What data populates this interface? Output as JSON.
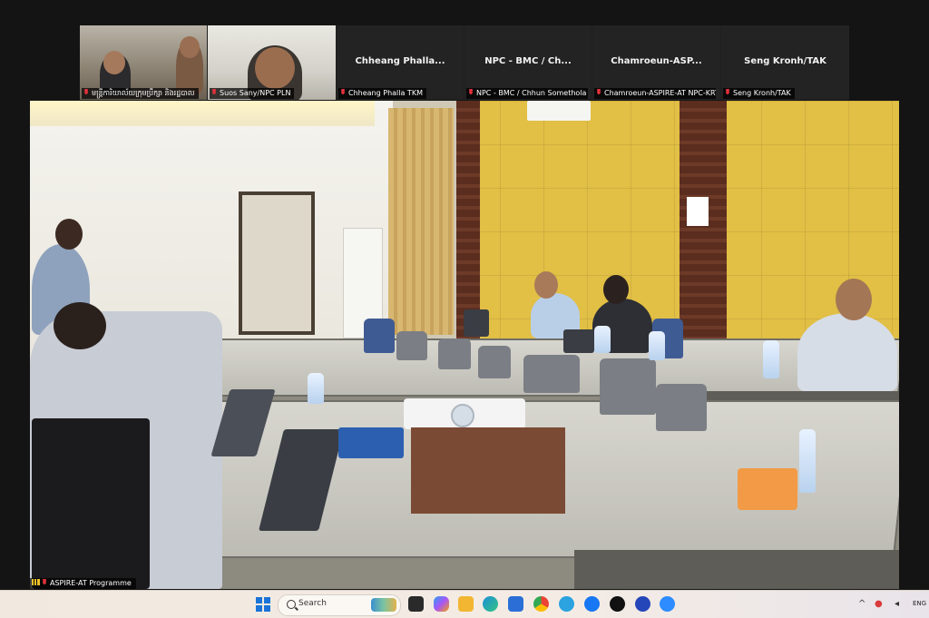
{
  "gallery": {
    "tiles": [
      {
        "name_label": "មន្ត្រីការិយាល័យក្រុមប្រឹក្សា និងរដ្ឋបាល",
        "has_video": true
      },
      {
        "name_label": "Suos Sany/NPC PLN",
        "has_video": true
      },
      {
        "display_name": "Chheang  Phalla...",
        "name_label": "Chheang Phalla TKM",
        "has_video": false
      },
      {
        "display_name": "NPC - BMC /   Ch...",
        "name_label": "NPC - BMC /  Chhun Somethola",
        "has_video": false
      },
      {
        "display_name": "Chamroeun-ASP...",
        "name_label": "Chamroeun-ASPIRE-AT NPC-KRT",
        "has_video": false
      },
      {
        "display_name": "Seng Kronh/TAK",
        "name_label": "Seng Kronh/TAK",
        "has_video": false
      }
    ]
  },
  "main_video": {
    "name_label": "ASPIRE-AT Programme"
  },
  "taskbar": {
    "search_placeholder": "Search",
    "language": "ENG",
    "pinned_icons": [
      "windows-start-icon",
      "search-icon",
      "task-view-icon",
      "copilot-icon",
      "file-explorer-icon",
      "edge-icon",
      "store-icon",
      "chrome-icon",
      "telegram-icon",
      "facebook-icon",
      "tiktok-icon",
      "app-icon",
      "zoom-icon"
    ],
    "tray_icons": [
      "chevron-up-icon",
      "network-icon",
      "volume-icon"
    ]
  },
  "colors": {
    "mic_muted": "#e0313a",
    "zoom_blue": "#2d8cff",
    "wall_yellow": "#e2bf45"
  }
}
